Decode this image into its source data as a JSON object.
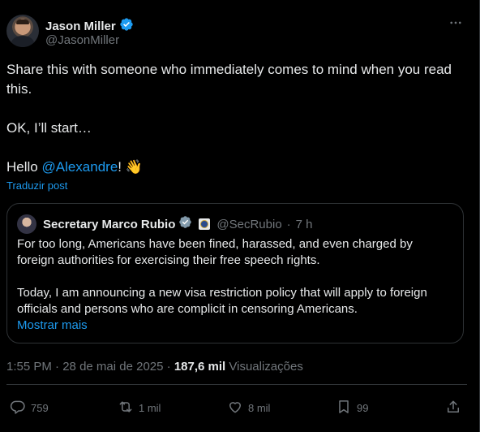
{
  "author": {
    "name": "Jason Miller",
    "handle": "@JasonMiller"
  },
  "tweet": {
    "line1": "Share this with someone who immediately comes to mind when you read this.",
    "line2": "OK, I’ll start…",
    "hello_prefix": "Hello ",
    "mention": "@Alexandre",
    "hello_suffix": "!",
    "emoji": "👋",
    "translate_label": "Traduzir post"
  },
  "quote": {
    "name": "Secretary Marco Rubio",
    "handle": "@SecRubio",
    "separator": "·",
    "time": "7 h",
    "para1": "For too long, Americans have been fined, harassed, and even charged by foreign authorities for exercising their free speech rights.",
    "para2": "Today, I am announcing a new visa restriction policy that will apply to foreign officials and persons who are complicit in censoring Americans.",
    "show_more": "Mostrar mais"
  },
  "meta": {
    "time": "1:55 PM",
    "sep1": "·",
    "date": "28 de mai de 2025",
    "sep2": "·",
    "views": "187,6 mil",
    "views_label": "Visualizações"
  },
  "actions": {
    "replies": "759",
    "reposts": "1 mil",
    "likes": "8 mil",
    "bookmarks": "99"
  },
  "colors": {
    "background": "#000000",
    "text": "#e7e9ea",
    "muted": "#71767b",
    "accent": "#1d9bf0",
    "border": "#2f3336",
    "verified": "#1d9bf0",
    "verified_gray": "#829aab"
  },
  "icons": [
    "verified-badge-icon",
    "more-icon",
    "reply-icon",
    "repost-icon",
    "like-icon",
    "bookmark-icon",
    "share-icon"
  ]
}
